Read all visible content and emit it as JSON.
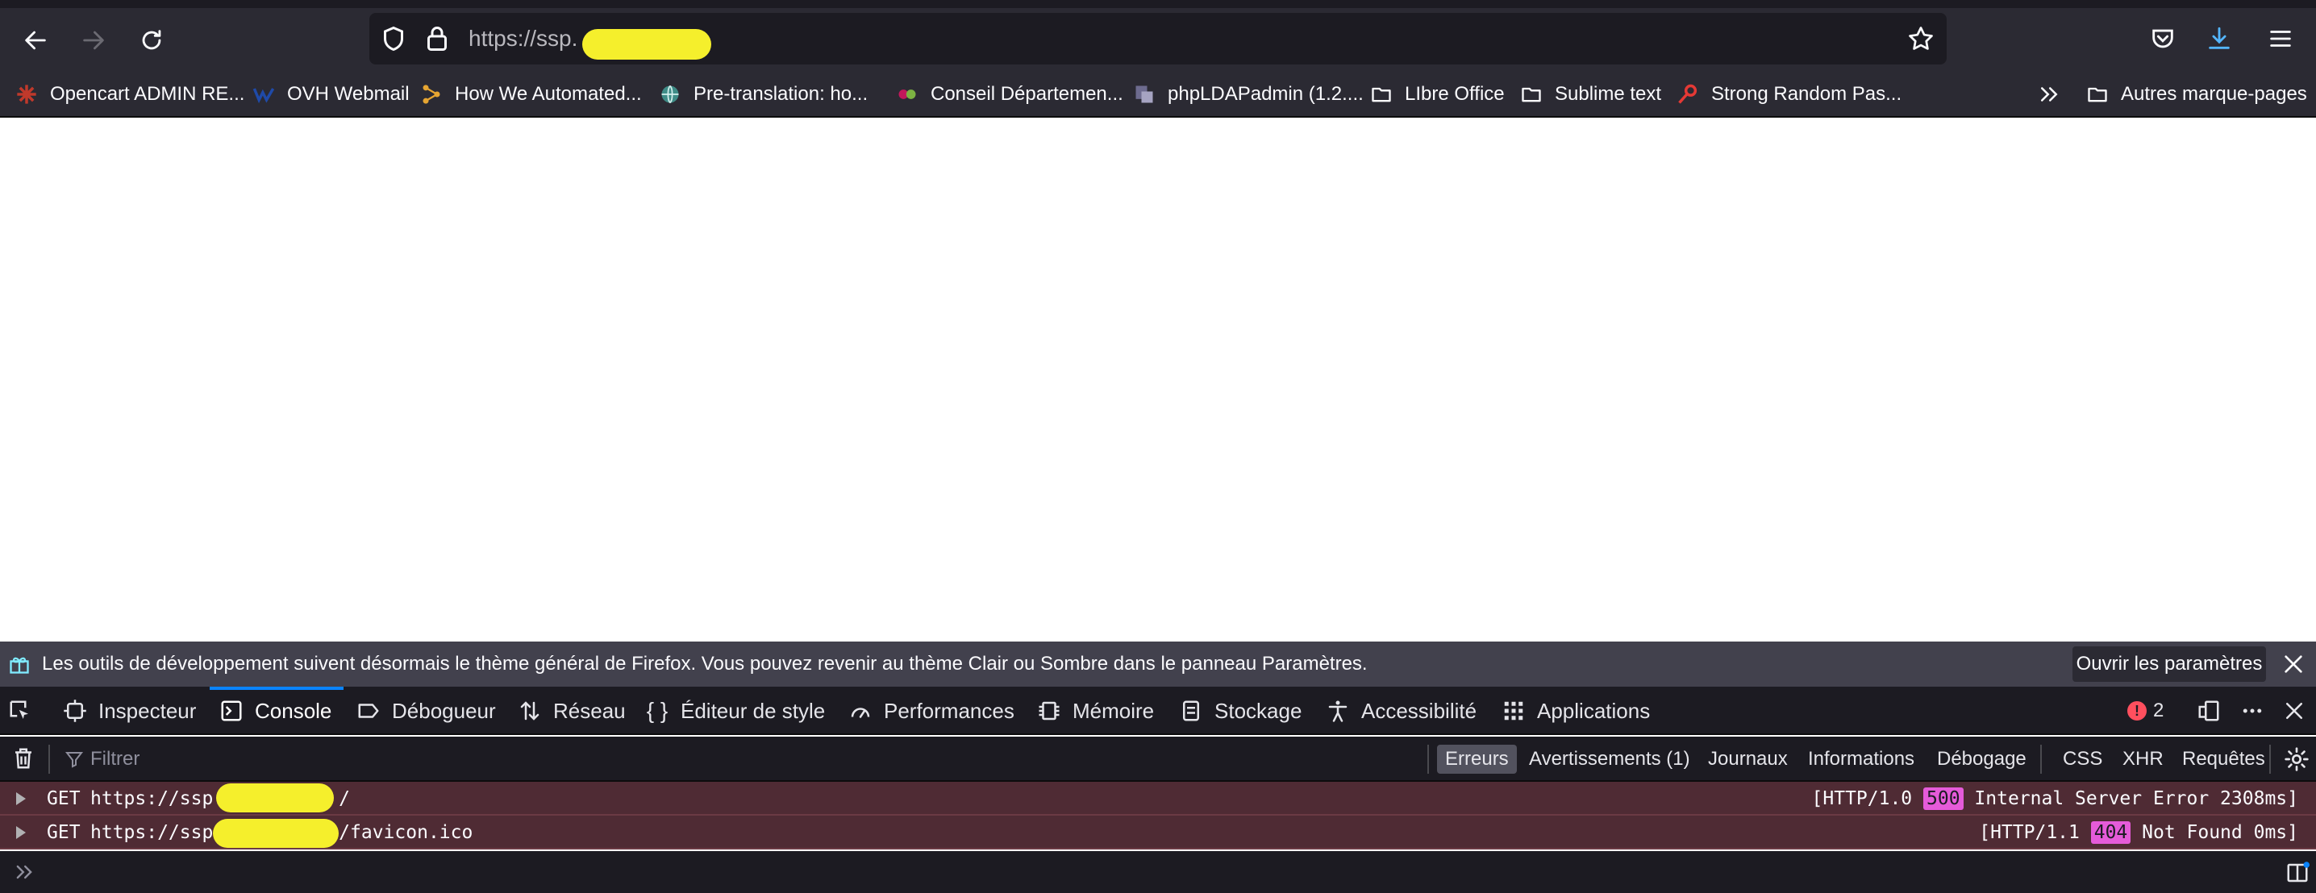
{
  "browser": {
    "url": "https://ssp.",
    "bookmarks": [
      {
        "label": "Opencart ADMIN RE...",
        "icon": "opencart-icon"
      },
      {
        "label": "OVH Webmail",
        "icon": "ovh-icon"
      },
      {
        "label": "How We Automated...",
        "icon": "automation-icon"
      },
      {
        "label": "Pre-translation: ho...",
        "icon": "globe-icon"
      },
      {
        "label": "Conseil Départemen...",
        "icon": "conseil-icon"
      },
      {
        "label": "phpLDAPadmin (1.2....",
        "icon": "ldap-icon"
      },
      {
        "label": "LIbre Office",
        "icon": "folder-icon"
      },
      {
        "label": "Sublime text",
        "icon": "folder-icon"
      },
      {
        "label": "Strong Random Pas...",
        "icon": "key-icon"
      }
    ],
    "other_bookmarks": "Autres marque-pages"
  },
  "devtools": {
    "notice": "Les outils de développement suivent désormais le thème général de Firefox. Vous pouvez revenir au thème Clair ou Sombre dans le panneau Paramètres.",
    "notice_button": "Ouvrir les paramètres",
    "tabs": [
      {
        "label": "Inspecteur",
        "icon": "inspector-icon"
      },
      {
        "label": "Console",
        "icon": "console-icon"
      },
      {
        "label": "Débogueur",
        "icon": "debugger-icon"
      },
      {
        "label": "Réseau",
        "icon": "network-icon"
      },
      {
        "label": "Éditeur de style",
        "icon": "style-editor-icon"
      },
      {
        "label": "Performances",
        "icon": "performance-icon"
      },
      {
        "label": "Mémoire",
        "icon": "memory-icon"
      },
      {
        "label": "Stockage",
        "icon": "storage-icon"
      },
      {
        "label": "Accessibilité",
        "icon": "accessibility-icon"
      },
      {
        "label": "Applications",
        "icon": "applications-icon"
      }
    ],
    "selected_tab": "Console",
    "error_count": "2",
    "filter_placeholder": "Filtrer",
    "filter_tabs": [
      "Erreurs",
      "Avertissements (1)",
      "Journaux",
      "Informations",
      "Débogage",
      "CSS",
      "XHR",
      "Requêtes"
    ],
    "active_filter": "Erreurs",
    "messages": [
      {
        "method": "GET",
        "url_prefix": "https://ssp.",
        "url_suffix": "/",
        "protocol": "[HTTP/1.0",
        "code": "500",
        "status": "Internal Server Error 2308ms]"
      },
      {
        "method": "GET",
        "url_prefix": "https://ssp.",
        "url_suffix": "/favicon.ico",
        "protocol": "[HTTP/1.1",
        "code": "404",
        "status": "Not Found 0ms]"
      }
    ]
  },
  "colors": {
    "chrome_bg": "#2b2a33",
    "devtools_bg": "#1c1b22",
    "error_row_bg": "#4f2b34",
    "accent_blue": "#0a84ff",
    "status_badge": "#e55bd9",
    "redaction_yellow": "#f5ef2c"
  }
}
